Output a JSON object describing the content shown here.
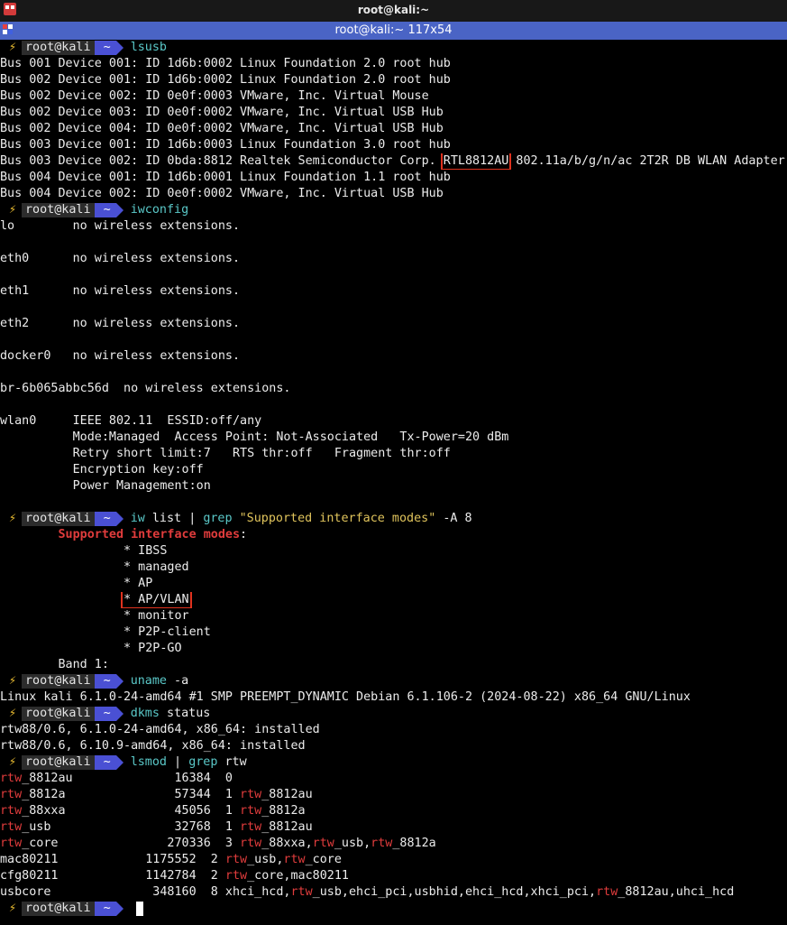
{
  "window": {
    "title": "root@kali:~"
  },
  "tab": {
    "title": "root@kali:~ 117x54"
  },
  "prompt": {
    "bolt": "⚡",
    "user": "root@kali",
    "dir": "~"
  },
  "lsusb": {
    "cmd": "lsusb",
    "lines": [
      "Bus 001 Device 001: ID 1d6b:0002 Linux Foundation 2.0 root hub",
      "Bus 002 Device 001: ID 1d6b:0002 Linux Foundation 2.0 root hub",
      "Bus 002 Device 002: ID 0e0f:0003 VMware, Inc. Virtual Mouse",
      "Bus 002 Device 003: ID 0e0f:0002 VMware, Inc. Virtual USB Hub",
      "Bus 002 Device 004: ID 0e0f:0002 VMware, Inc. Virtual USB Hub",
      "Bus 003 Device 001: ID 1d6b:0003 Linux Foundation 3.0 root hub"
    ],
    "realtek_pre": "Bus 003 Device 002: ID 0bda:8812 Realtek Semiconductor Corp. ",
    "realtek_chip": "RTL8812AU",
    "realtek_post": " 802.11a/b/g/n/ac 2T2R DB WLAN Adapter",
    "lines_after": [
      "Bus 004 Device 001: ID 1d6b:0001 Linux Foundation 1.1 root hub",
      "Bus 004 Device 002: ID 0e0f:0002 VMware, Inc. Virtual USB Hub"
    ]
  },
  "iwconfig": {
    "cmd": "iwconfig",
    "lines": [
      "lo        no wireless extensions.",
      "",
      "eth0      no wireless extensions.",
      "",
      "eth1      no wireless extensions.",
      "",
      "eth2      no wireless extensions.",
      "",
      "docker0   no wireless extensions.",
      "",
      "br-6b065abbc56d  no wireless extensions.",
      "",
      "wlan0     IEEE 802.11  ESSID:off/any",
      "          Mode:Managed  Access Point: Not-Associated   Tx-Power=20 dBm",
      "          Retry short limit:7   RTS thr:off   Fragment thr:off",
      "          Encryption key:off",
      "          Power Management:on",
      ""
    ]
  },
  "iwlist": {
    "cmd": "iw",
    "args1": " list ",
    "pipe": "| ",
    "grep": "grep",
    "pattern": "\"Supported interface modes\"",
    "args2": " -A 8",
    "heading_indent": "        ",
    "heading": "Supported interface modes",
    "heading_colon": ":",
    "modes_indent": "                 ",
    "modes": [
      "* IBSS",
      "* managed",
      "* AP"
    ],
    "mode_boxed": "* AP/VLAN",
    "modes_after": [
      "* monitor",
      "* P2P-client",
      "* P2P-GO"
    ],
    "band": "        Band 1:"
  },
  "uname": {
    "cmd": "uname",
    "args": " -a",
    "output": "Linux kali 6.1.0-24-amd64 #1 SMP PREEMPT_DYNAMIC Debian 6.1.106-2 (2024-08-22) x86_64 GNU/Linux"
  },
  "dkms": {
    "cmd": "dkms",
    "args": " status",
    "lines": [
      "rtw88/0.6, 6.1.0-24-amd64, x86_64: installed",
      "rtw88/0.6, 6.10.9-amd64, x86_64: installed"
    ]
  },
  "lsmod": {
    "cmd": "lsmod",
    "args": " | ",
    "grep": "grep",
    "pattern": " rtw",
    "rows": [
      [
        [
          "r",
          "rtw"
        ],
        [
          "t",
          "_8812au              16384  0"
        ]
      ],
      [
        [
          "r",
          "rtw"
        ],
        [
          "t",
          "_8812a               57344  1 "
        ],
        [
          "r",
          "rtw"
        ],
        [
          "t",
          "_8812au"
        ]
      ],
      [
        [
          "r",
          "rtw"
        ],
        [
          "t",
          "_88xxa               45056  1 "
        ],
        [
          "r",
          "rtw"
        ],
        [
          "t",
          "_8812a"
        ]
      ],
      [
        [
          "r",
          "rtw"
        ],
        [
          "t",
          "_usb                 32768  1 "
        ],
        [
          "r",
          "rtw"
        ],
        [
          "t",
          "_8812au"
        ]
      ],
      [
        [
          "r",
          "rtw"
        ],
        [
          "t",
          "_core               270336  3 "
        ],
        [
          "r",
          "rtw"
        ],
        [
          "t",
          "_88xxa,"
        ],
        [
          "r",
          "rtw"
        ],
        [
          "t",
          "_usb,"
        ],
        [
          "r",
          "rtw"
        ],
        [
          "t",
          "_8812a"
        ]
      ],
      [
        [
          "t",
          "mac80211            1175552  2 "
        ],
        [
          "r",
          "rtw"
        ],
        [
          "t",
          "_usb,"
        ],
        [
          "r",
          "rtw"
        ],
        [
          "t",
          "_core"
        ]
      ],
      [
        [
          "t",
          "cfg80211            1142784  2 "
        ],
        [
          "r",
          "rtw"
        ],
        [
          "t",
          "_core,mac80211"
        ]
      ],
      [
        [
          "t",
          "usbcore              348160  8 xhci_hcd,"
        ],
        [
          "r",
          "rtw"
        ],
        [
          "t",
          "_usb,ehci_pci,usbhid,ehci_hcd,xhci_pci,"
        ],
        [
          "r",
          "rtw"
        ],
        [
          "t",
          "_8812au,uhci_hcd"
        ]
      ]
    ]
  }
}
